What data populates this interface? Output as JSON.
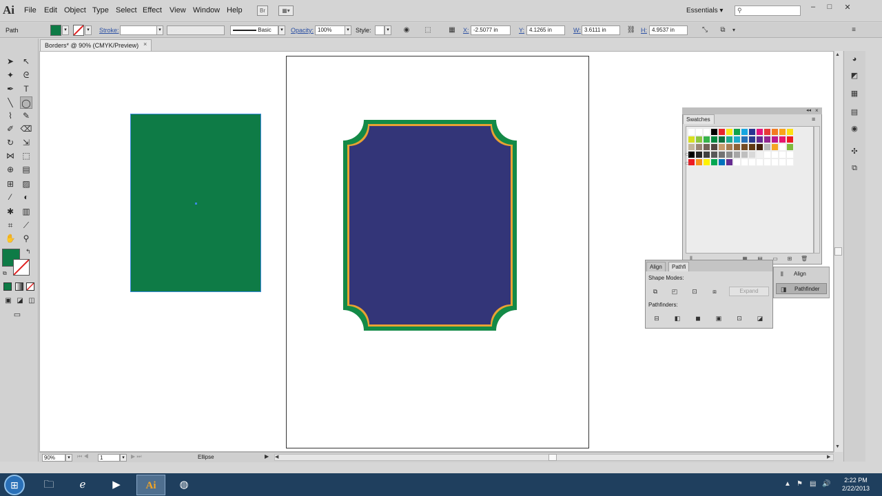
{
  "app": {
    "logo": "Ai",
    "menu": [
      "File",
      "Edit",
      "Object",
      "Type",
      "Select",
      "Effect",
      "View",
      "Window",
      "Help"
    ],
    "bridge_label": "Br",
    "workspace": "Essentials",
    "window_controls": [
      "–",
      "□",
      "✕"
    ]
  },
  "control_bar": {
    "selection_type": "Path",
    "fill_color": "#0e7b46",
    "stroke_label": "Stroke:",
    "brush_label": "Basic",
    "opacity_label": "Opacity:",
    "opacity_value": "100%",
    "style_label": "Style:",
    "x_label": "X:",
    "x_value": "-2.5077 in",
    "y_label": "Y:",
    "y_value": "4.1265 in",
    "w_label": "W:",
    "w_value": "3.6111 in",
    "h_label": "H:",
    "h_value": "4.9537 in"
  },
  "document": {
    "tab_title": "Borders* @ 90% (CMYK/Preview)",
    "tab_close": "×",
    "zoom": "90%",
    "artboard_number": "1",
    "status_tool": "Ellipse"
  },
  "artwork": {
    "rect_color": "#0e7b46",
    "frame_outer_color": "#138a47",
    "frame_trim_color": "#e8a233",
    "frame_inner_color": "#333578"
  },
  "swatches_panel": {
    "title": "Swatches",
    "rows": [
      [
        "#ffffff",
        "#ffffff",
        "#ffffff",
        "#000000",
        "#e8252b",
        "#fbe816",
        "#0ea24b",
        "#16a6e0",
        "#2a3491",
        "#e2167f",
        "#e73a36",
        "#f37a21",
        "#f9a21b",
        "#fde013"
      ],
      [
        "#d7df21",
        "#8dc63f",
        "#37b34a",
        "#00873e",
        "#0f6f3b",
        "#1bab8f",
        "#20a9cb",
        "#2671b6",
        "#2a3a8e",
        "#652d90",
        "#92278f",
        "#bd1a8d",
        "#e8166f",
        "#ed1c24"
      ],
      [
        "#c2b59b",
        "#998675",
        "#736357",
        "#534741",
        "#c69c6d",
        "#a67c52",
        "#8c6239",
        "#754c24",
        "#603913",
        "#42210b",
        "#b8b8b8",
        "#f5a623",
        "#ffffff",
        "#7fba3c"
      ],
      [
        "#000000",
        "#262626",
        "#404040",
        "#595959",
        "#737373",
        "#8c8c8c",
        "#a6a6a6",
        "#bfbfbf",
        "#d9d9d9",
        "#f2f2f2",
        "#ffffff",
        "#ffffff",
        "#ffffff",
        "#ffffff"
      ],
      [
        "#ed1c24",
        "#f7941d",
        "#fff200",
        "#00a651",
        "#0072bc",
        "#662d91",
        "#ffffff",
        "#ffffff",
        "#ffffff",
        "#ffffff",
        "#ffffff",
        "#ffffff",
        "#ffffff",
        "#ffffff"
      ]
    ]
  },
  "pathfinder_panel": {
    "tab_align": "Align",
    "tab_pathfinder": "Pathfi",
    "shape_modes_label": "Shape Modes:",
    "expand_label": "Expand",
    "pathfinders_label": "Pathfinders:"
  },
  "mini_dock": {
    "align": "Align",
    "pathfinder": "Pathfinder"
  },
  "taskbar": {
    "time": "2:22 PM",
    "date": "2/22/2013",
    "ai_label": "Ai"
  }
}
